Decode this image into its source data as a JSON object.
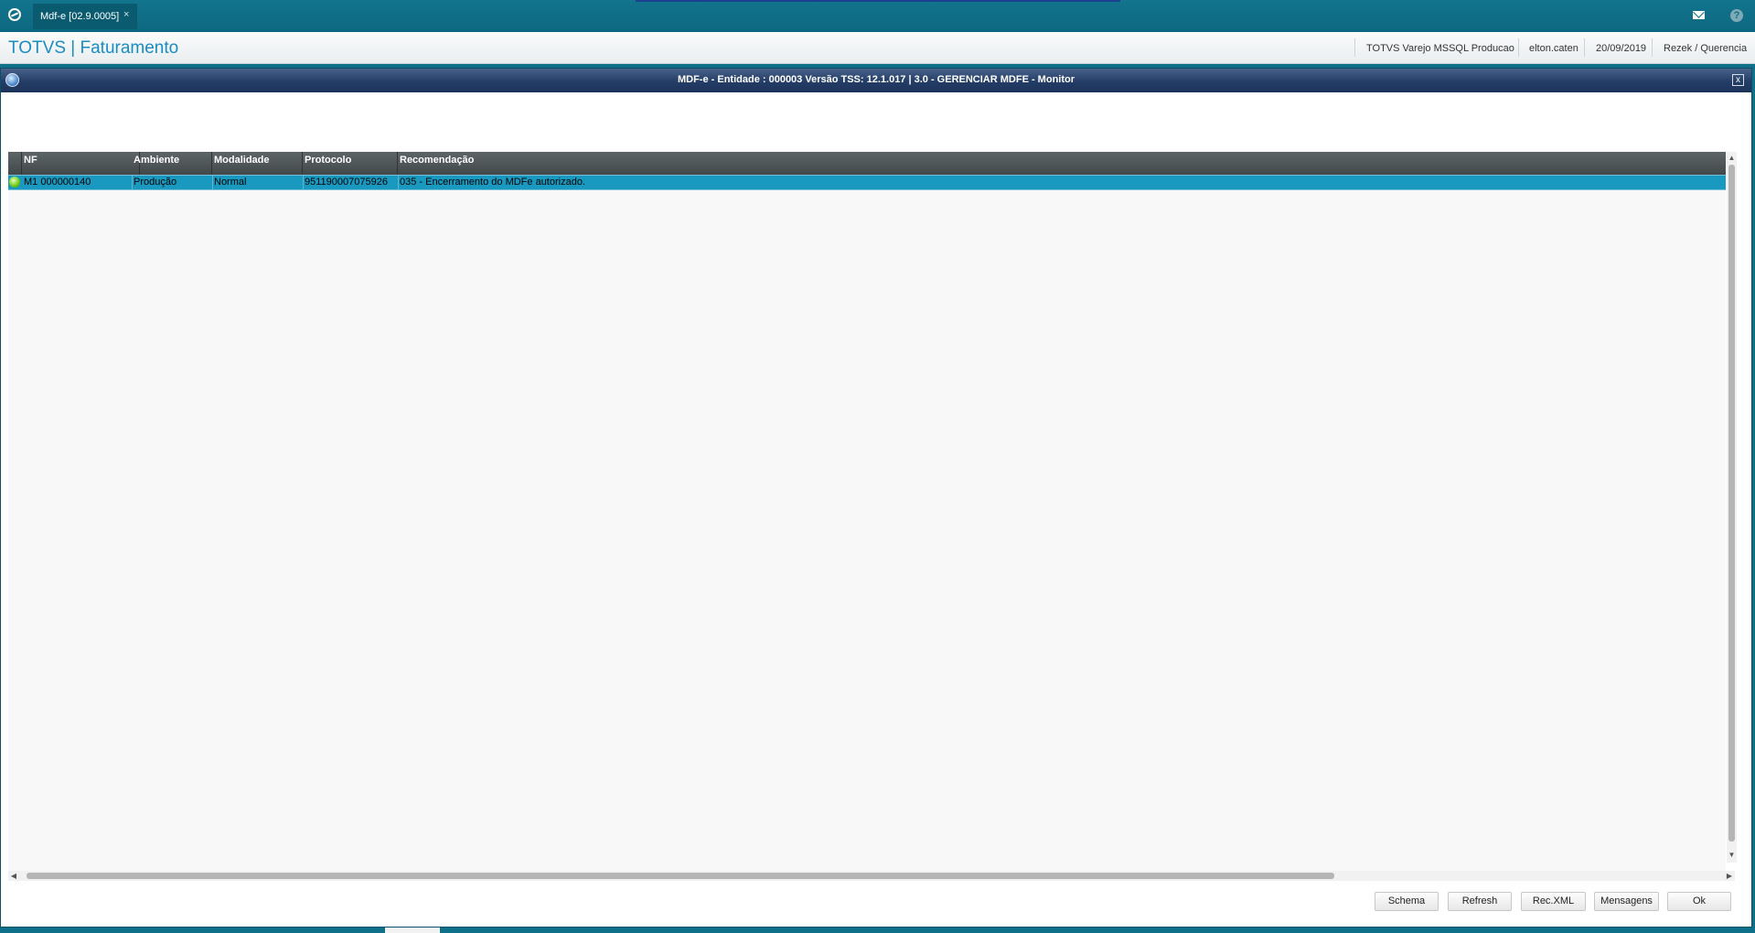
{
  "tabbar": {
    "tab_label": "Mdf-e [02.9.0005]",
    "tab_close": "×",
    "mail_icon": "mail-icon",
    "help_icon": "?"
  },
  "header": {
    "app_title": "TOTVS | Faturamento",
    "environment": "TOTVS Varejo MSSQL Producao",
    "user": "elton.caten",
    "date": "20/09/2019",
    "company": "Rezek / Querencia"
  },
  "dialog": {
    "title": "MDF-e - Entidade : 000003 Versão TSS: 12.1.017 | 3.0 - GERENCIAR MDFE - Monitor",
    "close_glyph": "x"
  },
  "grid": {
    "columns": [
      "NF",
      "Ambiente",
      "Modalidade",
      "Protocolo",
      "Recomendação"
    ],
    "rows": [
      {
        "status": "green",
        "nf": "M1 000000140",
        "ambiente": "Produção",
        "modalidade": "Normal",
        "protocolo": "951190007075926",
        "recomendacao": "035 - Encerramento do MDFe autorizado."
      }
    ]
  },
  "buttons": {
    "schema": "Schema",
    "refresh": "Refresh",
    "rec_xml": "Rec.XML",
    "mensagens": "Mensagens",
    "ok": "Ok"
  },
  "colors": {
    "chrome": "#0e7089",
    "title_accent": "#1a8cc2",
    "selected_row": "#1999bf",
    "status_ok": "#6cc618"
  }
}
